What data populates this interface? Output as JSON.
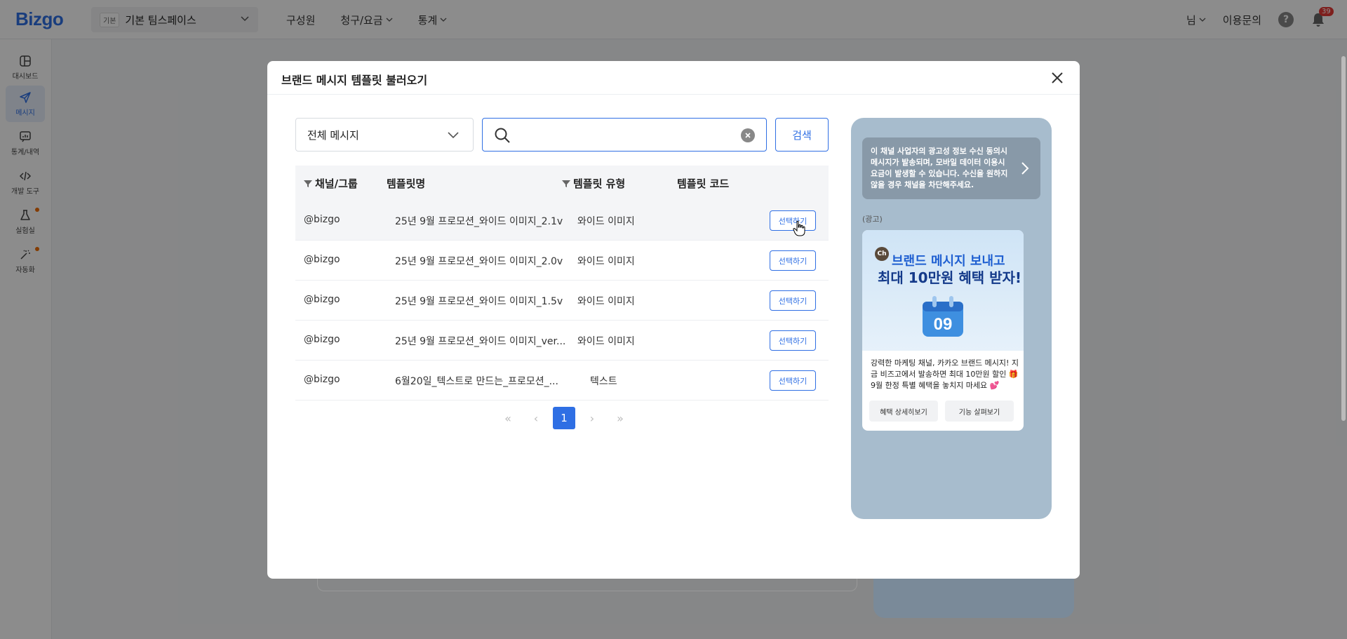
{
  "app": {
    "logo": "Bizgo",
    "workspace_badge": "기본",
    "workspace_name": "기본 팀스페이스",
    "nav": [
      "구성원",
      "청구/요금",
      "통계"
    ],
    "user_label": "님",
    "inquiry_label": "이용문의",
    "help_label": "?",
    "notification_count": "39"
  },
  "sidebar": [
    {
      "label": "대시보드",
      "icon": "dashboard-icon"
    },
    {
      "label": "메시지",
      "icon": "send-icon",
      "active": true
    },
    {
      "label": "통계/내역",
      "icon": "stats-icon"
    },
    {
      "label": "개발 도구",
      "icon": "code-icon"
    },
    {
      "label": "실험실",
      "icon": "flask-icon",
      "dot": true
    },
    {
      "label": "자동화",
      "icon": "magic-wand-icon",
      "dot": true
    }
  ],
  "modal": {
    "title": "브랜드 메시지 템플릿 불러오기",
    "filter_value": "전체 메시지",
    "search_placeholder": "",
    "search_button": "검색",
    "columns": [
      "채널/그룹",
      "템플릿명",
      "템플릿 유형",
      "템플릿 코드"
    ],
    "rows": [
      {
        "channel": "@bizgo",
        "name": "25년 9월 프로모션_와이드 이미지_2.1v",
        "type": "와이드 이미지",
        "code": "",
        "action": "선택하기"
      },
      {
        "channel": "@bizgo",
        "name": "25년 9월 프로모션_와이드 이미지_2.0v",
        "type": "와이드 이미지",
        "code": "",
        "action": "선택하기"
      },
      {
        "channel": "@bizgo",
        "name": "25년 9월 프로모션_와이드 이미지_1.5v",
        "type": "와이드 이미지",
        "code": "",
        "action": "선택하기"
      },
      {
        "channel": "@bizgo",
        "name": "25년 9월 프로모션_와이드 이미지_ver...",
        "type": "와이드 이미지",
        "code": "",
        "action": "선택하기"
      },
      {
        "channel": "@bizgo",
        "name": "6월20일_텍스트로 만드는_프로모션_...",
        "type": "텍스트",
        "code": "",
        "action": "선택하기"
      }
    ],
    "pagination": {
      "current": "1",
      "first": "«",
      "prev": "‹",
      "next": "›",
      "last": "»"
    }
  },
  "preview": {
    "notice": "이 채널 사업자의 광고성 정보 수신 동의시 메시지가 발송되며, 모바일 데이터 이용시 요금이 발생할 수 있습니다. 수신을 원하지 않을 경우 채널을 차단해주세요.",
    "ad_label": "(광고)",
    "ch_badge": "Ch",
    "headline1": "브랜드 메시지 보내고",
    "headline2": "최대 10만원 혜택 받자!",
    "calendar_number": "09",
    "body": "강력한 마케팅 채널, 카카오 브랜드 메시지! 지금 비즈고에서 발송하면 최대 10만원 할인 🎁 9월 한정 특별 혜택을 놓치지 마세요 💕",
    "button1": "혜택 상세히보기",
    "button2": "기능 살펴보기"
  },
  "colors": {
    "accent": "#2f6fe4",
    "preview_bg": "#a7bccd",
    "notice_bg": "#8899a8"
  }
}
